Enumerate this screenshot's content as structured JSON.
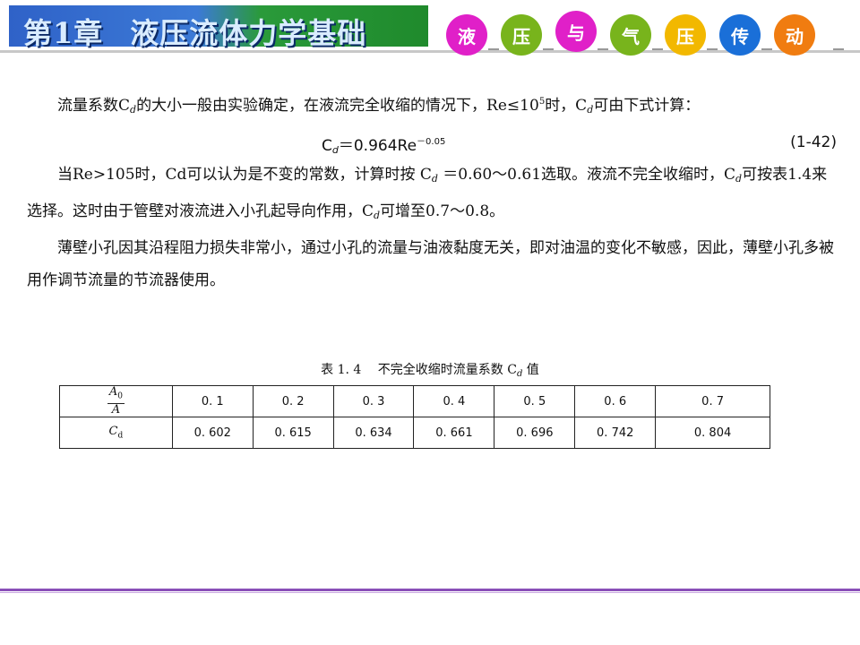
{
  "header": {
    "chapter": "第1章",
    "title": "液压流体力学基础",
    "bubbles": [
      {
        "char": "液",
        "color": "#e020c8"
      },
      {
        "char": "压",
        "color": "#78b41c"
      },
      {
        "char": "与",
        "color": "#e020c8"
      },
      {
        "char": "气",
        "color": "#78b41c"
      },
      {
        "char": "压",
        "color": "#f2b800"
      },
      {
        "char": "传",
        "color": "#1a6fd8"
      },
      {
        "char": "动",
        "color": "#f07c10"
      }
    ]
  },
  "body": {
    "p1_a": "流量系数C",
    "p1_sub": "d",
    "p1_b": "的大小一般由实验确定，在液流完全收缩的情况下，Re≤10",
    "p1_sup": "5",
    "p1_c": "时，C",
    "p1_sub2": "d",
    "p1_d": "可由下式计算：",
    "formula_a": "C",
    "formula_sub": "d",
    "formula_b": "＝0.964Re",
    "formula_sup": "－0.05",
    "formula_no": "(1-42)",
    "p2_a": "当Re>105时，Cd可以认为是不变的常数，计算时按 C",
    "p2_sub": "d",
    "p2_b": " ＝0.60～0.61选取。液流不完全收缩时，C",
    "p2_sub2": "d",
    "p2_c": "可按表1.4来选择。这时由于管壁对液流进入小孔起导向作用，C",
    "p2_sub3": "d",
    "p2_d": "可增至0.7～0.8。",
    "p3": "薄壁小孔因其沿程阻力损失非常小，通过小孔的流量与油液黏度无关，即对油温的变化不敏感，因此，薄壁小孔多被用作调节流量的节流器使用。"
  },
  "table": {
    "caption_a": "表 1. 4　 不完全收缩时流量系数 C",
    "caption_sub": "d",
    "caption_b": " 值",
    "row1_label_num": "A",
    "row1_label_num_sub": "0",
    "row1_label_den": "A",
    "row2_label": "C",
    "row2_label_sub": "d",
    "ratios": [
      "0. 1",
      "0. 2",
      "0. 3",
      "0. 4",
      "0. 5",
      "0. 6",
      "0. 7"
    ],
    "cd_values": [
      "0. 602",
      "0. 615",
      "0. 634",
      "0. 661",
      "0. 696",
      "0. 742",
      "0. 804"
    ]
  }
}
